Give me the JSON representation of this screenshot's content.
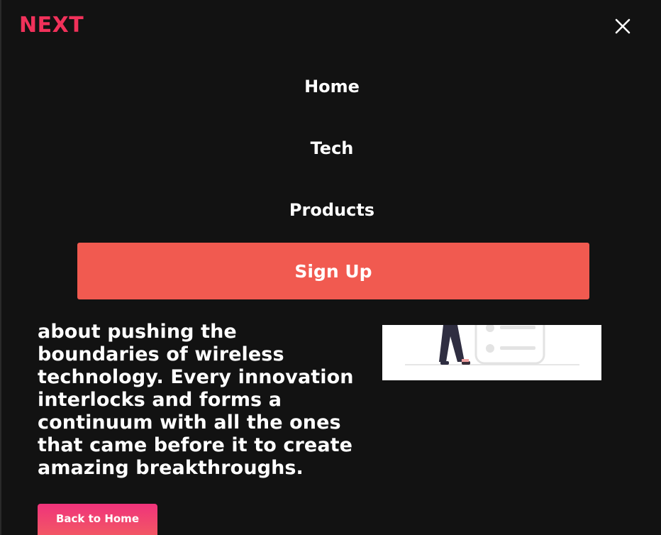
{
  "header": {
    "logo_text": "NEXT",
    "close_icon": "close-icon"
  },
  "nav": {
    "items": [
      {
        "label": "Home"
      },
      {
        "label": "Tech"
      },
      {
        "label": "Products"
      }
    ],
    "signup_label": "Sign Up"
  },
  "content": {
    "paragraph": "about pushing the boundaries of wireless technology. Every innovation interlocks and forms a continuum with all the ones that came before it to create amazing breakthroughs.",
    "back_label": "Back to Home"
  },
  "colors": {
    "background": "#121212",
    "brand": "#f0315a",
    "signup": "#f15a50",
    "back_gradient_start": "#f0337b",
    "back_gradient_end": "#f25a63"
  }
}
